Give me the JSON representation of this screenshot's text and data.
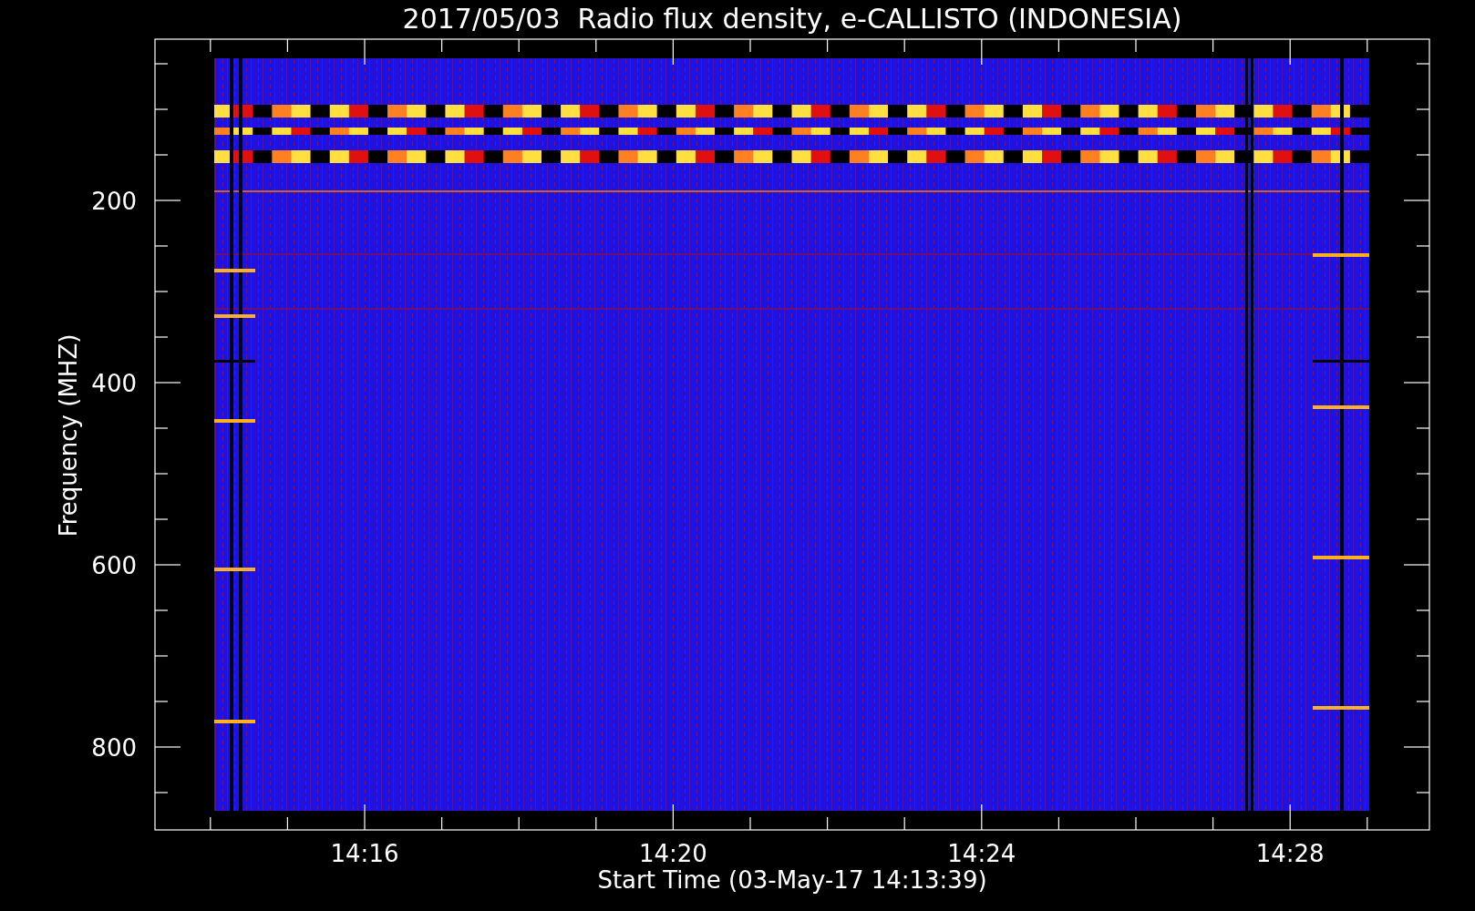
{
  "chart": {
    "title": "2017/05/03  Radio flux density, e-CALLISTO (INDONESIA)",
    "ylabel": "Frequency (MHZ)",
    "xlabel": "Start Time (03-May-17 14:13:39)",
    "yticks": [
      "200",
      "400",
      "600",
      "800"
    ],
    "xticks": [
      "14:16",
      "14:20",
      "14:24",
      "14:28"
    ]
  }
}
